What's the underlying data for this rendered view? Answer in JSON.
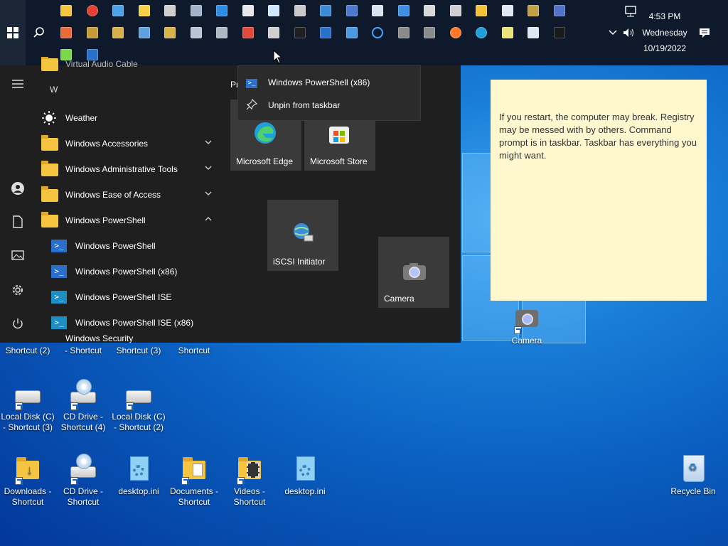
{
  "taskbar": {
    "clock_time": "4:53 PM",
    "clock_day": "Wednesday",
    "clock_date": "10/19/2022",
    "row1_icons": [
      "file-explorer-icon",
      "chrome-icon",
      "network-icon",
      "sticky-notes-icon",
      "settings-icon",
      "cloud-icon",
      "ie-icon",
      "paint-icon",
      "notepad-icon",
      "controller-icon",
      "remote-desktop-icon",
      "remote-connect-icon",
      "shield-app-icon",
      "grid-icon",
      "print-icon",
      "printer-icon",
      "media-player-icon",
      "wordpad-icon",
      "dvd-icon",
      "screen-icon"
    ],
    "row2_icons": [
      "scan-icon",
      "drive-icon",
      "registry-icon",
      "search-app-icon",
      "lock-icon",
      "computer-icon",
      "server-icon",
      "no-entry-icon",
      "fax-icon",
      "cmd-icon",
      "powershell-icon",
      "monitor-icon",
      "cortana-icon",
      "calculator-icon",
      "camera-icon",
      "firefox-icon",
      "edge-icon",
      "notes-icon",
      "defender-icon",
      "security-icon"
    ],
    "row3_icons": [
      "battery-icon",
      "powershell-small-icon"
    ]
  },
  "start_menu": {
    "section_letter": "W",
    "partial_top": "Virtual Audio Cable",
    "items": [
      {
        "label": "Weather",
        "icon": "weather-icon",
        "type": "app"
      },
      {
        "label": "Windows Accessories",
        "icon": "folder-icon",
        "type": "folder",
        "expanded": false
      },
      {
        "label": "Windows Administrative Tools",
        "icon": "folder-icon",
        "type": "folder",
        "expanded": false
      },
      {
        "label": "Windows Ease of Access",
        "icon": "folder-icon",
        "type": "folder",
        "expanded": false
      },
      {
        "label": "Windows PowerShell",
        "icon": "folder-icon",
        "type": "folder",
        "expanded": true
      },
      {
        "label": "Windows PowerShell",
        "icon": "powershell-icon",
        "type": "app"
      },
      {
        "label": "Windows PowerShell (x86)",
        "icon": "powershell-icon",
        "type": "app"
      },
      {
        "label": "Windows PowerShell ISE",
        "icon": "powershell-ise-icon",
        "type": "app"
      },
      {
        "label": "Windows PowerShell ISE (x86)",
        "icon": "powershell-ise-icon",
        "type": "app"
      }
    ],
    "partial_bottom": "Windows Security",
    "tiles_header_partial": "Pr",
    "tiles": [
      {
        "label": "Microsoft Edge",
        "icon": "edge-icon"
      },
      {
        "label": "Microsoft Store",
        "icon": "store-icon"
      },
      {
        "label": "iSCSI Initiator",
        "icon": "iscsi-icon"
      },
      {
        "label": "Camera",
        "icon": "camera-icon"
      }
    ]
  },
  "context_menu": {
    "items": [
      {
        "label": "Windows PowerShell (x86)",
        "icon": "powershell-icon"
      },
      {
        "label": "Unpin from taskbar",
        "icon": "unpin-icon"
      }
    ]
  },
  "sticky_note": {
    "text": "If you restart, the computer may break. Registry may be messed with by others. Command prompt is in taskbar. Taskbar has everything you might want."
  },
  "desktop": {
    "partial_row": [
      "Shortcut (2)",
      "- Shortcut",
      "Shortcut (3)",
      "Shortcut"
    ],
    "icons": [
      {
        "label": "Local Disk (C) - Shortcut (3)",
        "kind": "disk"
      },
      {
        "label": "CD Drive - Shortcut (4)",
        "kind": "cd"
      },
      {
        "label": "Local Disk (C) - Shortcut (2)",
        "kind": "disk"
      },
      {
        "label": "Downloads - Shortcut",
        "kind": "folder"
      },
      {
        "label": "CD Drive - Shortcut",
        "kind": "cd"
      },
      {
        "label": "desktop.ini",
        "kind": "ini"
      },
      {
        "label": "Documents - Shortcut",
        "kind": "folder"
      },
      {
        "label": "Videos - Shortcut",
        "kind": "folder"
      },
      {
        "label": "desktop.ini",
        "kind": "ini"
      },
      {
        "label": "Recycle Bin",
        "kind": "recycle"
      },
      {
        "label": "Camera",
        "kind": "camera"
      }
    ]
  }
}
